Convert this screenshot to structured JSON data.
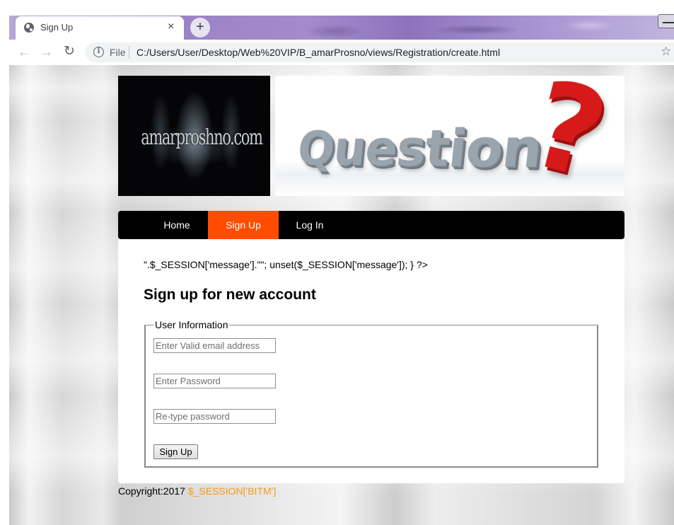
{
  "browser": {
    "tab_title": "Sign Up",
    "tab_close": "×",
    "new_tab": "+",
    "file_label": "File",
    "url": "C:/Users/User/Desktop/Web%20VIP/B_amarProsno/views/Registration/create.html",
    "icons": {
      "favicon": "globe-icon",
      "back": "arrow-left-icon",
      "forward": "arrow-right-icon",
      "reload": "reload-icon",
      "info": "info-icon",
      "bookmark": "star-icon"
    }
  },
  "header": {
    "logo_text": "amarproshno.com",
    "banner_word": "Question",
    "banner_mark": "?"
  },
  "nav": {
    "items": [
      {
        "label": "Home",
        "active": false
      },
      {
        "label": "Sign Up",
        "active": true
      },
      {
        "label": "Log In",
        "active": false
      }
    ],
    "active_color": "#ff4c00"
  },
  "main": {
    "php_message": "\".$_SESSION['message'].\"\"; unset($_SESSION['message']); } ?>",
    "heading": "Sign up for new account",
    "fieldset_legend": "User Information",
    "fields": {
      "email_placeholder": "Enter Valid email address",
      "password_placeholder": "Enter Password",
      "repassword_placeholder": "Re-type password"
    },
    "submit_label": "Sign Up"
  },
  "footer": {
    "copyright": "Copyright:2017",
    "session_text": "$_SESSION['BITM']",
    "session_color": "#f39c12"
  }
}
